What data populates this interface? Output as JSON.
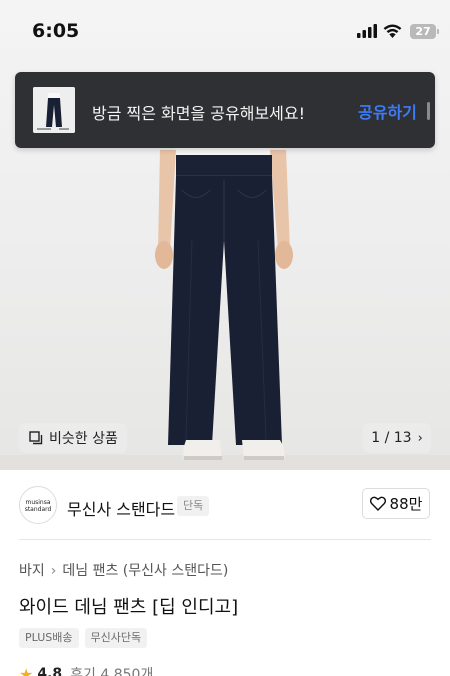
{
  "status_bar": {
    "time": "6:05",
    "battery": "27"
  },
  "toast": {
    "message": "방금 찍은 화면을 공유해보세요!",
    "share_label": "공유하기",
    "accent_color": "#3d7cf7"
  },
  "gallery": {
    "similar_label": "비슷한 상품",
    "page_indicator": "1 / 13"
  },
  "brand": {
    "logo_text": "musinsa standard",
    "name": "무신사 스탠다드",
    "badge": "단독",
    "like_count": "88만"
  },
  "product": {
    "breadcrumb": [
      "바지",
      "데님 팬츠 (무신사 스탠다드)"
    ],
    "title": "와이드 데님 팬츠 [딥 인디고]",
    "tags": [
      "PLUS배송",
      "무신사단독"
    ],
    "rating": "4.8",
    "review_label": "후기 4,850개"
  },
  "icons": {
    "signal": "signal-icon",
    "wifi": "wifi-icon",
    "similar": "similar-products-icon",
    "pager_next": "chevron-right-icon",
    "like": "heart-icon",
    "rating": "star-icon"
  }
}
